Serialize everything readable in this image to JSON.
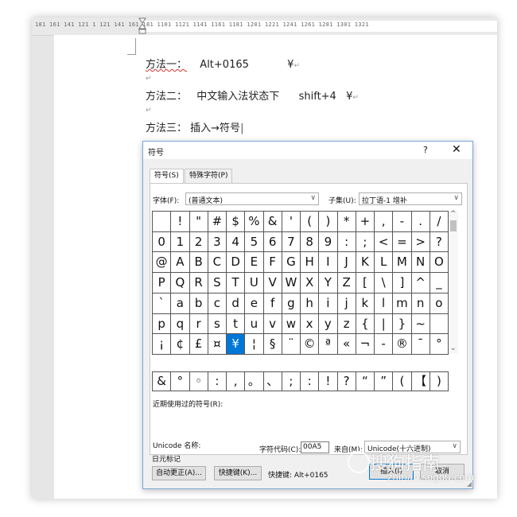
{
  "ruler": {
    "numbers": "181  161  141  121  1     121  141  161  181  1101  1121  1141  1161  1181  1201  1221  1241  1261  1281  1301  1321"
  },
  "document": {
    "method1": {
      "label": "方法一：",
      "text": "Alt+0165",
      "symbol": "¥"
    },
    "method2": {
      "label": "方法二：",
      "text": "中文输入法状态下",
      "shortcut": "shift+4",
      "symbol": "¥"
    },
    "method3": {
      "label": "方法三：",
      "text": "插入→符号"
    },
    "paragraph_mark": "↵"
  },
  "dialog": {
    "title": "符号",
    "help": "?",
    "close": "✕",
    "tabs": [
      {
        "label": "符号(S)"
      },
      {
        "label": "特殊字符(P)"
      }
    ],
    "font_label": "字体(F):",
    "font_value": "(普通文本)",
    "subset_label": "子集(U):",
    "subset_value": "拉丁语-1 增补",
    "rows": [
      [
        " ",
        "!",
        "\"",
        "#",
        "$",
        "%",
        "&",
        "'",
        "(",
        ")",
        "*",
        "+",
        ",",
        "-",
        ".",
        "/"
      ],
      [
        "0",
        "1",
        "2",
        "3",
        "4",
        "5",
        "6",
        "7",
        "8",
        "9",
        ":",
        ";",
        "<",
        "=",
        ">",
        "?"
      ],
      [
        "@",
        "A",
        "B",
        "C",
        "D",
        "E",
        "F",
        "G",
        "H",
        "I",
        "J",
        "K",
        "L",
        "M",
        "N",
        "O"
      ],
      [
        "P",
        "Q",
        "R",
        "S",
        "T",
        "U",
        "V",
        "W",
        "X",
        "Y",
        "Z",
        "[",
        "\\",
        "]",
        "^",
        "_"
      ],
      [
        "`",
        "a",
        "b",
        "c",
        "d",
        "e",
        "f",
        "g",
        "h",
        "i",
        "j",
        "k",
        "l",
        "m",
        "n",
        "o"
      ],
      [
        "p",
        "q",
        "r",
        "s",
        "t",
        "u",
        "v",
        "w",
        "x",
        "y",
        "z",
        "{",
        "|",
        "}",
        "~",
        ""
      ],
      [
        "¡",
        "¢",
        "£",
        "¤",
        "¥",
        "¦",
        "§",
        "¨",
        "©",
        "ª",
        "«",
        "¬",
        "-",
        "®",
        "¯",
        "°"
      ]
    ],
    "selected_symbol": "¥",
    "recent_label": "近期使用过的符号(R):",
    "recent": [
      "&",
      "°",
      "◦",
      ":",
      ",",
      "。",
      "、",
      ";",
      ":",
      "!",
      "?",
      "“",
      "”",
      "(",
      "【",
      ")"
    ],
    "unicode_name_label": "Unicode 名称:",
    "unicode_name_value": "日元标记",
    "char_code_label": "字符代码(C):",
    "char_code_value": "00A5",
    "from_label": "来自(M):",
    "from_value": "Unicode(十六进制)",
    "autocorrect_button": "自动更正(A)...",
    "shortcut_key_button": "快捷键(K)...",
    "shortcut_key_text": "快捷键: Alt+0165",
    "insert_button": "插入(I)",
    "cancel_button": "取消"
  },
  "watermark": {
    "main": "搜狗指南",
    "sub": "zhinan.sogou.com"
  }
}
